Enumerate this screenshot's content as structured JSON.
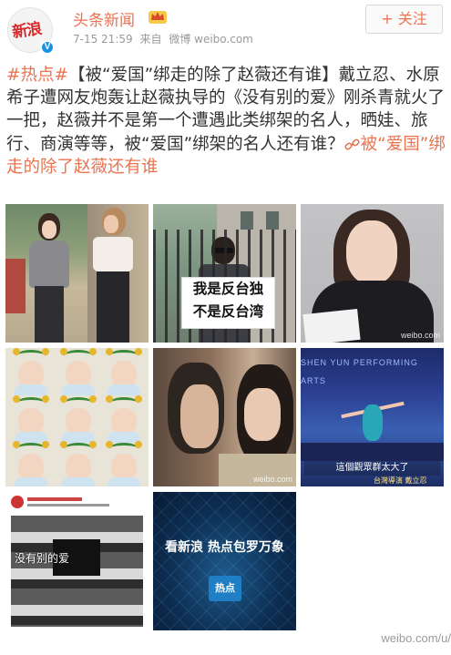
{
  "post": {
    "user_name": "头条新闻",
    "avatar_text": "新浪",
    "verified_badge": "V",
    "time": "7-15 21:59",
    "source_prefix": "来自",
    "source": "微博 weibo.com",
    "follow_label": "+ 关注",
    "hashtag": "#热点#",
    "body": "【被“爱国”绑走的除了赵薇还有谁】戴立忍、水原希子遭网友炮轰让赵薇执导的《没有别的爱》刚杀青就火了一把，赵薇并不是第一个遭遇此类绑架的名人，晒娃、旅行、商演等等，被“爱国”绑架的名人还有谁？",
    "link_text": "被“爱国”绑走的除了赵薇还有谁"
  },
  "images": {
    "sign_line1": "我是反台独",
    "sign_line2": "不是反台湾",
    "watermark": "weibo.com",
    "stage_caption": "這個觀眾群太大了",
    "stage_header": "SHEN YUN PERFORMING ARTS",
    "stage_footer": "台灣導演 戴立忍",
    "collage_text": "没有别的爱",
    "slogan": "看新浪 热点包罗万象",
    "slogan_logo": "热点"
  },
  "footer_watermark": "weibo.com/u/"
}
